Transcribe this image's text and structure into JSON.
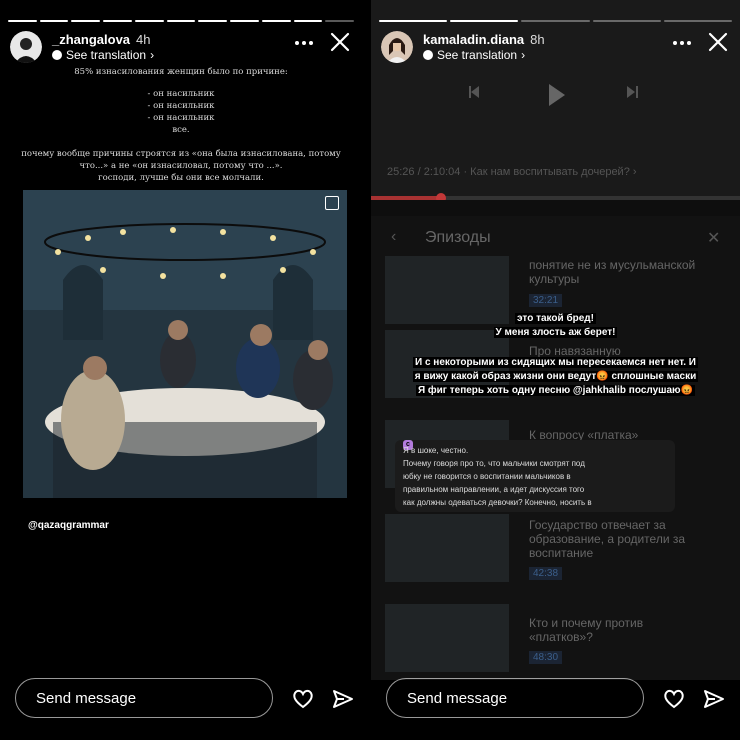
{
  "left_story": {
    "username": "_zhangalova",
    "time": "4h",
    "translate_label": "See translation",
    "text_lines_top": [
      "85% изнасилования женщин было по причине:"
    ],
    "text_list": [
      "- он насильник",
      "- он насильник",
      "- он насильник",
      "все."
    ],
    "text_lines_bottom": [
      "почему вообще причины строятся из «она была изнасилована, потому",
      "что...» а не «он изнасиловал, потому что ...».",
      "господи, лучше бы они все молчали."
    ],
    "handle": "@qazaqgrammar",
    "send_placeholder": "Send message"
  },
  "right_story": {
    "username": "kamaladin.diana",
    "time": "8h",
    "translate_label": "See translation",
    "video_time": "25:26 / 2:10:04 · Как нам воспитывать дочерей? ›",
    "episodes_title": "Эпизоды",
    "episodes": [
      {
        "title": "понятие не из мусульманской культуры",
        "duration": "32:21"
      },
      {
        "title": "Про навязанную",
        "duration": ""
      },
      {
        "title": "К вопросу «платка»",
        "duration": ""
      },
      {
        "title": "Государство отвечает за образование, а родители за воспитание",
        "duration": "42:38"
      },
      {
        "title": "Кто и почему против «платков»?",
        "duration": "48:30"
      }
    ],
    "overlay_lines": [
      "это такой бред!",
      "У меня злость аж берет!",
      "И с некоторыми из сидящих мы пересекаемся нет нет. И",
      "я вижу какой образ жизни они ведут😡 сплошные маски",
      "Я фиг теперь хоть одну песню @jahkhalib послушаю😡"
    ],
    "comment_lines": [
      "Я в шоке, честно.",
      "Почему говоря про то, что мальчики смотрят под",
      "юбку не говорится о воспитании мальчиков в",
      "правильном направлении, а идет дискуссия того",
      "как должны одеваться девочки? Конечно, носить в"
    ],
    "send_placeholder": "Send message"
  },
  "colors": {
    "background": "#000000",
    "accent_red": "#e53935",
    "duration_blue": "#3b5e8a"
  }
}
